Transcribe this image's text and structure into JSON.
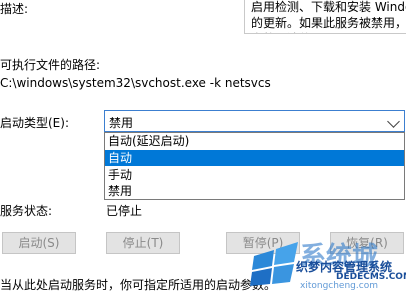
{
  "labels": {
    "description": "描述:",
    "exe_path": "可执行文件的路径:",
    "startup_type": "启动类型(E):",
    "service_status": "服务状态:"
  },
  "description_text": "启用检测、下载和安装 Windows 和其他程序的更新。如果此服务被禁用，这台计算机的用户将无法使用",
  "exe_path_value": "C:\\windows\\system32\\svchost.exe -k netsvcs",
  "startup_select": {
    "value": "禁用",
    "options": [
      "自动(延迟启动)",
      "自动",
      "手动",
      "禁用"
    ],
    "highlighted": "自动"
  },
  "status_value": "已停止",
  "buttons": {
    "start": "启动(S)",
    "stop": "停止(T)",
    "pause": "暂停(P)",
    "resume": "恢复(R)"
  },
  "footer_note": "当从此处启动服务时，你可指定所适用的启动参数。",
  "watermark": {
    "brand": "系统城",
    "site": "xitongcheng.com",
    "caption": "织梦内容管理系统",
    "url": "DEDECMS.COM"
  },
  "colors": {
    "accent": "#0078d7",
    "select_border": "#3c7fd0",
    "button_bg": "#e3e3e3",
    "disabled_text": "#8a8a8a",
    "watermark_blue": "#1e6fc5"
  }
}
